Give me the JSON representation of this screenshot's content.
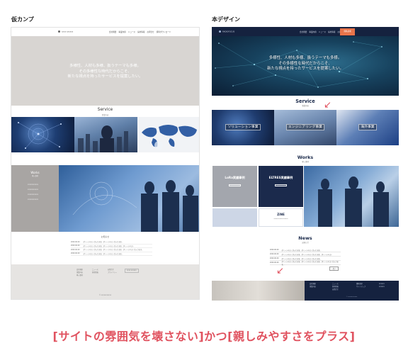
{
  "labels": {
    "left": "仮カンプ",
    "right": "本デザイン"
  },
  "left_mock": {
    "logo": "xxxx xxxxxx",
    "nav": [
      "会社概要",
      "事業内容",
      "ニュース",
      "採用情報",
      "お問合せ",
      "資料ダウンロード"
    ],
    "hero_lines": [
      "多様性、人材も多様、扱うテーマも多様。",
      "その多様性な時代だからこそ、",
      "新たな視点を持ったサービスを提案したい。"
    ],
    "service_title": "Service",
    "service_sub": "事業内容",
    "works_title": "Works",
    "works_sub": "導入事例",
    "works_items": [
      "xxxxxxxxxxx",
      "xxxxxxxxxxx",
      "xxxxxxxxxxx",
      "xxxxxxxxxxx"
    ],
    "news_label": "お知らせ",
    "news": [
      {
        "date": "2020.00.00",
        "text": "ダミーテキストが入ります。ダミーテキストが入ります。"
      },
      {
        "date": "2020.00.00",
        "text": "ダミーテキストが入ります。ダミーテキストが入ります。ダミーテキスト"
      },
      {
        "date": "2020.00.00",
        "text": "ダミーテキストが入ります。ダミーテキストが入ります。ダミーテキストが入ります。"
      },
      {
        "date": "2020.00.00",
        "text": "ダミーテキストが入ります。ダミーテキストが入ります。"
      }
    ],
    "footer_cols": [
      [
        "会社概要",
        "事業内容",
        "導入事例"
      ],
      [
        "ニュース",
        "採用情報"
      ],
      [
        "お問合せ",
        "プライバシー"
      ]
    ],
    "footer_logo": "xxxx xxxxxx",
    "copyright": "© xxxxxxxxxxx"
  },
  "right_design": {
    "logo": "RADIOFOCUS",
    "nav": [
      "会社概要",
      "事業内容",
      "ニュース",
      "採用情報",
      "お問合せ"
    ],
    "cta": "資料請求",
    "hero_lines": [
      "多様性、人材も多様、扱うテーマも多様。",
      "その多様性な時代だからこそ、",
      "新たな視点を持ったサービスを提案したい。"
    ],
    "service_title": "Service",
    "service_sub": "事業内容",
    "services": [
      "ソリューション事業",
      "エンジニアリング事業",
      "海外事業"
    ],
    "works_title": "Works",
    "works_sub": "導入事例",
    "tiles": [
      {
        "title": "LoRa実績事例",
        "color": "#a3a6ad"
      },
      {
        "title": "ELTRES実績事例",
        "color": "#1b2a4c"
      },
      {
        "title": "",
        "color": "#cdd6e6"
      },
      {
        "title": "ZiNE",
        "sub": "xxxxxxxxxxxxxxxxx",
        "color": "#ffffff"
      }
    ],
    "news_title": "News",
    "news_sub": "お知らせ",
    "news": [
      {
        "date": "2020.00.00",
        "text": "ダミーテキストが入ります。ダミーテキストが入ります。"
      },
      {
        "date": "2020.00.00",
        "text": "ダミーテキストが入ります。ダミーテキストが入ります。ダミーテキスト"
      },
      {
        "date": "2020.00.00",
        "text": "ダミーテキストが入ります。ダミーテキストが入ります。"
      },
      {
        "date": "2020.00.00",
        "text": "ダミーテキストが入ります。ダミーテキストが入ります。ダミーテキストが入ります。"
      }
    ],
    "more": "一覧へ",
    "footer_cols": [
      [
        "会社概要",
        "事業内容"
      ],
      [
        "ニュース",
        "採用情報",
        "お問合せ"
      ],
      [
        "資料請求",
        "サイトマップ"
      ],
      [
        "xxxxxx",
        "xxxxxx"
      ]
    ],
    "copyright": "© xxxxxxxxxxx"
  },
  "caption": "[サイトの雰囲気を壊さない]かつ[親しみやすさをプラス]",
  "colors": {
    "accent": "#e0525f",
    "navy": "#15223f",
    "cta": "#e8744a"
  }
}
